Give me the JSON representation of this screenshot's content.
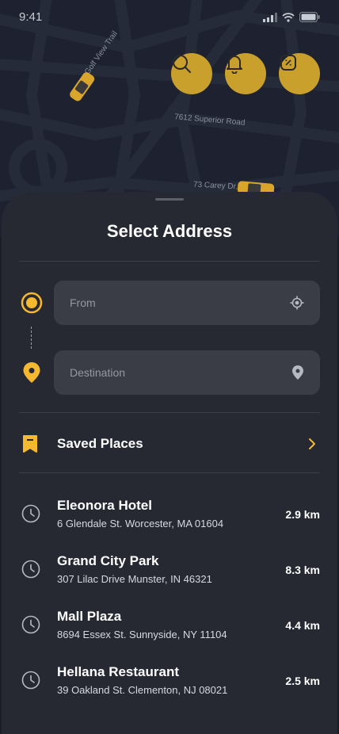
{
  "status_bar": {
    "time": "9:41"
  },
  "map": {
    "streets": [
      "Golf View Trail",
      "7612 Superior Road",
      "73 Carey Dr."
    ],
    "buttons": [
      {
        "name": "search",
        "icon": "search-icon"
      },
      {
        "name": "notifications",
        "icon": "bell-icon"
      },
      {
        "name": "promo",
        "icon": "discount-icon"
      }
    ]
  },
  "sheet": {
    "title": "Select Address",
    "from": {
      "placeholder": "From",
      "value": "",
      "icon": "crosshair-icon"
    },
    "destination": {
      "placeholder": "Destination",
      "value": "",
      "icon": "map-pin-icon"
    },
    "saved_places": {
      "label": "Saved Places"
    },
    "recent": [
      {
        "name": "Eleonora Hotel",
        "address": "6 Glendale St. Worcester, MA 01604",
        "distance": "2.9 km"
      },
      {
        "name": "Grand City Park",
        "address": "307 Lilac Drive Munster, IN 46321",
        "distance": "8.3 km"
      },
      {
        "name": "Mall Plaza",
        "address": "8694 Essex St. Sunnyside, NY 11104",
        "distance": "4.4 km"
      },
      {
        "name": "Hellana Restaurant",
        "address": "39 Oakland St. Clementon, NJ 08021",
        "distance": "2.5 km"
      }
    ]
  },
  "colors": {
    "accent": "#f5b82e",
    "sheet_bg": "#262932",
    "field_bg": "#3a3d46",
    "map_bg": "#1d2130"
  }
}
